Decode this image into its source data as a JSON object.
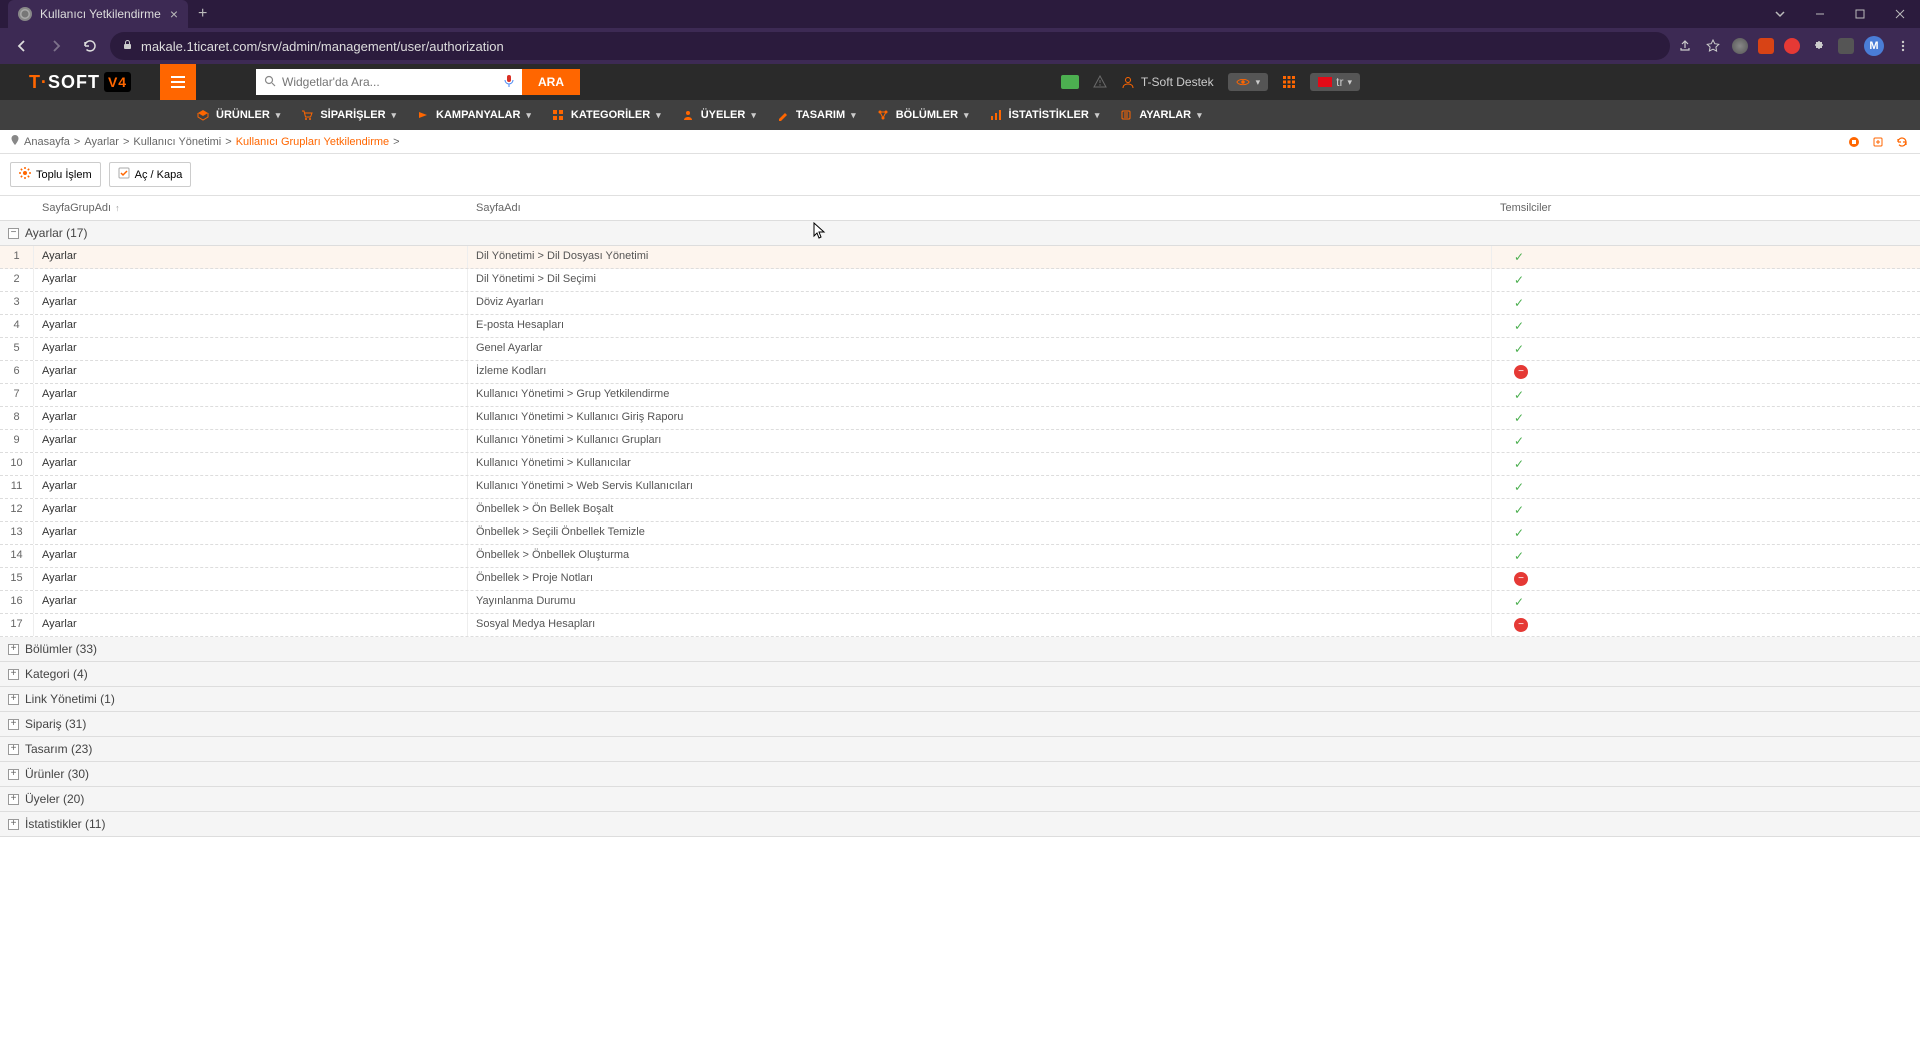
{
  "browser": {
    "tab_title": "Kullanıcı Yetkilendirme",
    "url": "makale.1ticaret.com/srv/admin/management/user/authorization",
    "avatar_initial": "M"
  },
  "header": {
    "search_placeholder": "Widgetlar'da Ara...",
    "search_button": "ARA",
    "support_label": "T-Soft Destek",
    "lang": "tr"
  },
  "logo": {
    "part1": "T·",
    "part2": "SOFT",
    "part3": "V4"
  },
  "nav": [
    {
      "label": "ÜRÜNLER"
    },
    {
      "label": "SİPARİŞLER"
    },
    {
      "label": "KAMPANYALAR"
    },
    {
      "label": "KATEGORİLER"
    },
    {
      "label": "ÜYELER"
    },
    {
      "label": "TASARIM"
    },
    {
      "label": "BÖLÜMLER"
    },
    {
      "label": "İSTATİSTİKLER"
    },
    {
      "label": "AYARLAR"
    }
  ],
  "breadcrumb": {
    "home": "Anasayfa",
    "p1": "Ayarlar",
    "p2": "Kullanıcı Yönetimi",
    "current": "Kullanıcı Grupları Yetkilendirme"
  },
  "toolbar": {
    "bulk_label": "Toplu İşlem",
    "toggle_label": "Aç / Kapa"
  },
  "columns": {
    "group": "SayfaGrupAdı",
    "page": "SayfaAdı",
    "reps": "Temsilciler"
  },
  "groups": {
    "expanded": {
      "label": "Ayarlar (17)"
    },
    "collapsed": [
      "Bölümler (33)",
      "Kategori (4)",
      "Link Yönetimi (1)",
      "Sipariş (31)",
      "Tasarım (23)",
      "Ürünler (30)",
      "Üyeler (20)",
      "İstatistikler (11)"
    ]
  },
  "rows": [
    {
      "n": "1",
      "g": "Ayarlar",
      "p": "Dil Yönetimi > Dil Dosyası Yönetimi",
      "s": "ok"
    },
    {
      "n": "2",
      "g": "Ayarlar",
      "p": "Dil Yönetimi > Dil Seçimi",
      "s": "ok"
    },
    {
      "n": "3",
      "g": "Ayarlar",
      "p": "Döviz Ayarları",
      "s": "ok"
    },
    {
      "n": "4",
      "g": "Ayarlar",
      "p": "E-posta Hesapları",
      "s": "ok"
    },
    {
      "n": "5",
      "g": "Ayarlar",
      "p": "Genel Ayarlar",
      "s": "ok"
    },
    {
      "n": "6",
      "g": "Ayarlar",
      "p": "İzleme Kodları",
      "s": "deny"
    },
    {
      "n": "7",
      "g": "Ayarlar",
      "p": "Kullanıcı Yönetimi > Grup Yetkilendirme",
      "s": "ok"
    },
    {
      "n": "8",
      "g": "Ayarlar",
      "p": "Kullanıcı Yönetimi > Kullanıcı Giriş Raporu",
      "s": "ok"
    },
    {
      "n": "9",
      "g": "Ayarlar",
      "p": "Kullanıcı Yönetimi > Kullanıcı Grupları",
      "s": "ok"
    },
    {
      "n": "10",
      "g": "Ayarlar",
      "p": "Kullanıcı Yönetimi > Kullanıcılar",
      "s": "ok"
    },
    {
      "n": "11",
      "g": "Ayarlar",
      "p": "Kullanıcı Yönetimi > Web Servis Kullanıcıları",
      "s": "ok"
    },
    {
      "n": "12",
      "g": "Ayarlar",
      "p": "Önbellek > Ön Bellek Boşalt",
      "s": "ok"
    },
    {
      "n": "13",
      "g": "Ayarlar",
      "p": "Önbellek > Seçili Önbellek Temizle",
      "s": "ok"
    },
    {
      "n": "14",
      "g": "Ayarlar",
      "p": "Önbellek > Önbellek Oluşturma",
      "s": "ok"
    },
    {
      "n": "15",
      "g": "Ayarlar",
      "p": "Önbellek > Proje Notları",
      "s": "deny"
    },
    {
      "n": "16",
      "g": "Ayarlar",
      "p": "Yayınlanma Durumu",
      "s": "ok"
    },
    {
      "n": "17",
      "g": "Ayarlar",
      "p": "Sosyal Medya Hesapları",
      "s": "deny"
    }
  ]
}
